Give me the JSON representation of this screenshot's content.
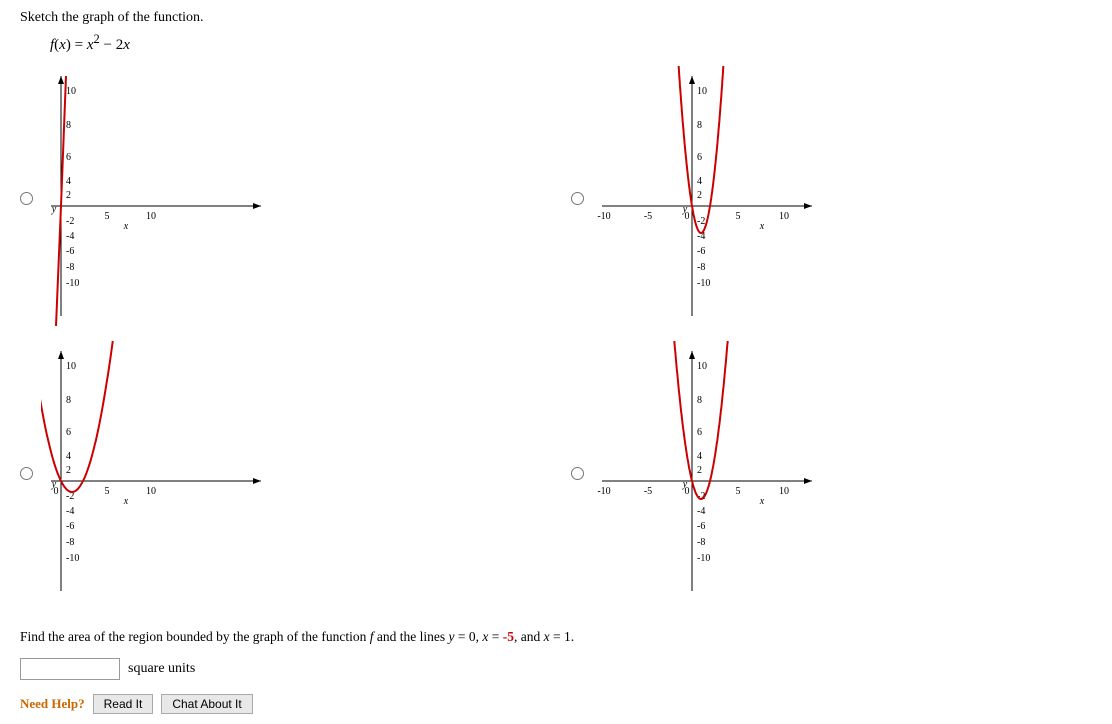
{
  "problem": {
    "title": "Sketch the graph of the function.",
    "function_display": "f(x) = x² − 2x",
    "function_raw": "f(x) = x^2 - 2x"
  },
  "graphs": [
    {
      "id": "A",
      "type": "cubic_like_steep"
    },
    {
      "id": "B",
      "type": "parabola_opens_up_shifted"
    },
    {
      "id": "C",
      "type": "parabola_opens_up_correct"
    },
    {
      "id": "D",
      "type": "cubic_like_shifted"
    }
  ],
  "area_question": {
    "text": "Find the area of the region bounded by the graph of the function f and the lines y = 0, x = -5, and x = 1.",
    "highlighted_parts": [
      "f",
      "y = 0",
      "x = -5",
      "x = 1"
    ]
  },
  "answer": {
    "placeholder": "",
    "unit": "square units"
  },
  "help": {
    "need_help_label": "Need Help?",
    "read_it_label": "Read It",
    "chat_about_it_label": "Chat About It"
  }
}
